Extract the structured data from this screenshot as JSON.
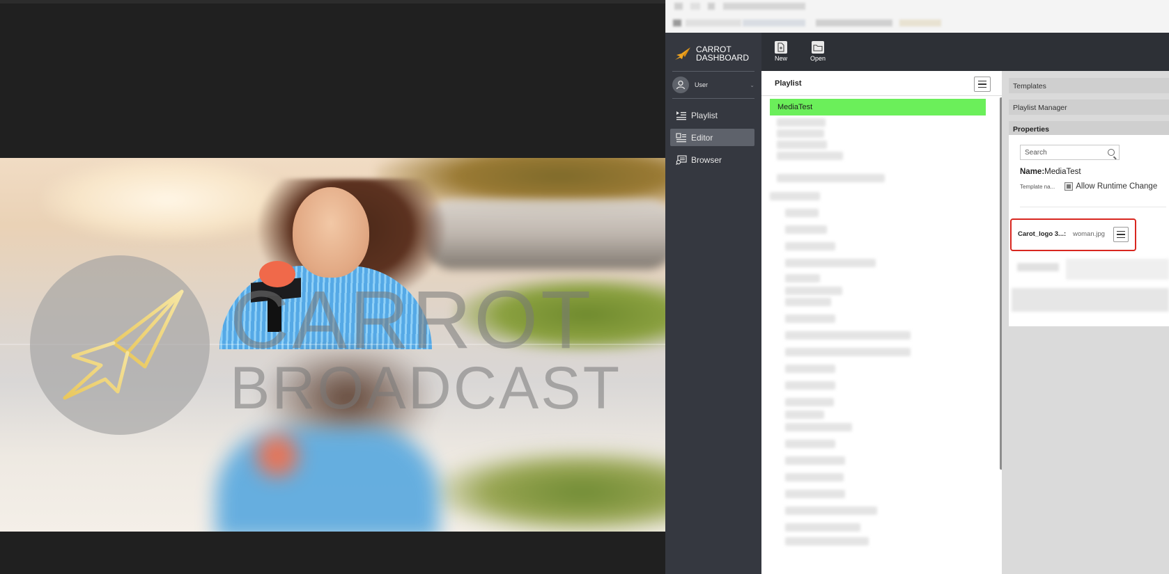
{
  "preview": {
    "logo_line1": "CARROT",
    "logo_line2": "BROADCAST"
  },
  "brand": {
    "name": "CARROT DASHBOARD",
    "accent_color": "#f0a520"
  },
  "user": {
    "label": "User"
  },
  "nav": {
    "items": [
      {
        "label": "Playlist",
        "icon": "playlist-icon",
        "active": false
      },
      {
        "label": "Editor",
        "icon": "editor-icon",
        "active": true
      },
      {
        "label": "Browser",
        "icon": "browser-icon",
        "active": false
      }
    ]
  },
  "toolbar": {
    "new_label": "New",
    "open_label": "Open"
  },
  "playlist": {
    "title": "Playlist",
    "selected_item": "MediaTest",
    "selected_color": "#6bef5a"
  },
  "right_panel": {
    "templates_label": "Templates",
    "playlist_manager_label": "Playlist Manager",
    "properties_label": "Properties"
  },
  "properties": {
    "search_placeholder": "Search",
    "name_label": "Name:",
    "name_value": "MediaTest",
    "template_name_label": "Template na...",
    "allow_runtime_label": "Allow Runtime Change",
    "field": {
      "name": "Carot_logo 3...:",
      "value": "woman.jpg",
      "highlight_color": "#d8261f"
    }
  }
}
